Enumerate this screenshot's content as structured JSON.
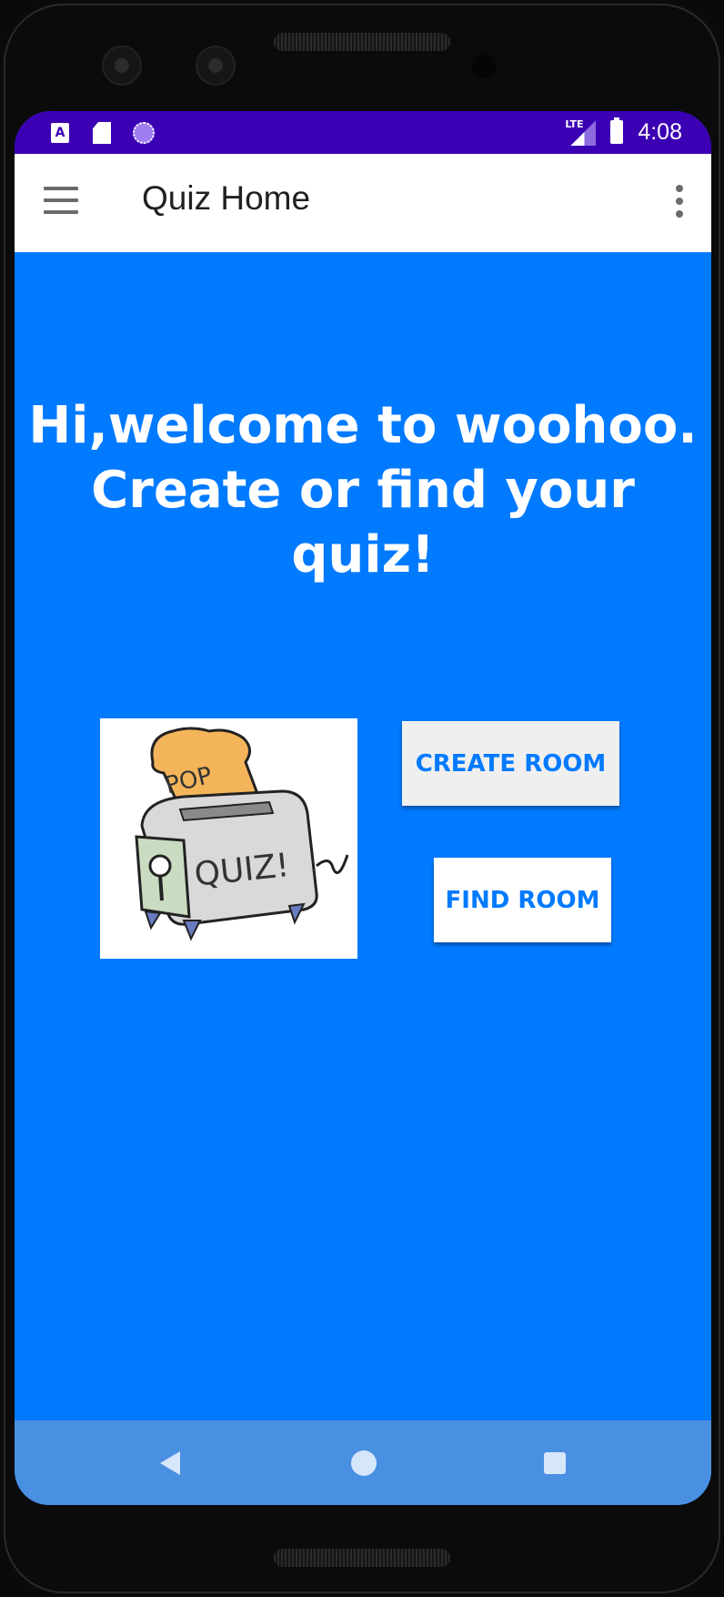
{
  "status_bar": {
    "icons": [
      "a-notification-icon",
      "sd-card-icon",
      "sync-icon"
    ],
    "network_label": "LTE",
    "time": "4:08"
  },
  "app_bar": {
    "title": "Quiz Home",
    "menu_icon": "hamburger-menu-icon",
    "overflow_icon": "more-vert-icon"
  },
  "main": {
    "welcome_line1": "Hi,welcome to woohoo.",
    "welcome_line2": "Create or find your quiz!",
    "image_text_top": "POP",
    "image_text_front": "QUIZ!",
    "create_room_label": "CREATE ROOM",
    "find_room_label": "FIND ROOM"
  },
  "colors": {
    "status_bar": "#3b00b3",
    "background": "#007aff",
    "nav_bar": "#4a90e2",
    "button_text": "#007aff"
  },
  "nav_bar": {
    "icons": [
      "back-icon",
      "home-icon",
      "recents-icon"
    ]
  }
}
